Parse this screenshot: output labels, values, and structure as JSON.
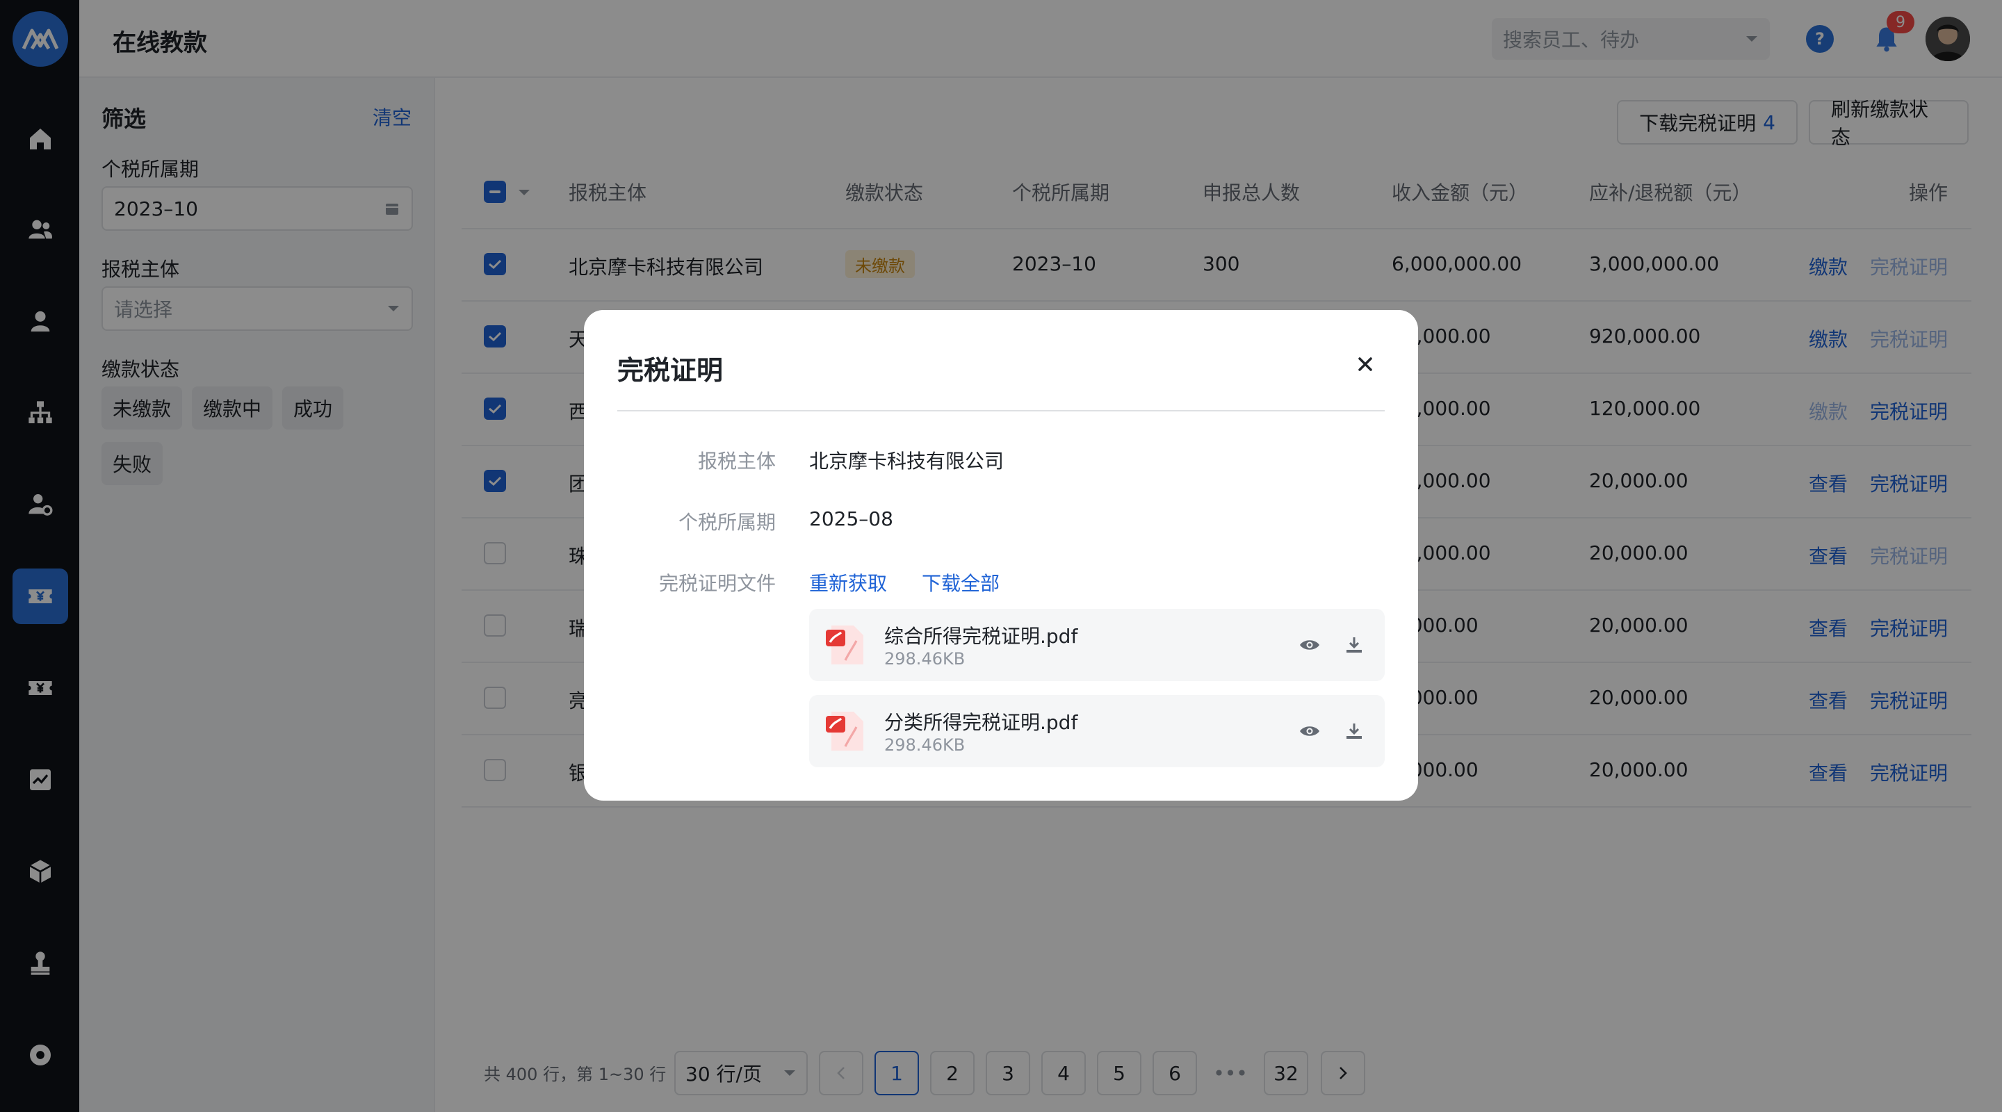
{
  "app": {
    "title": "在线教款"
  },
  "header": {
    "search_placeholder": "搜索员工、待办",
    "help": "?",
    "notification_count": "9"
  },
  "sidebar": {
    "items": [
      "home-icon",
      "team-icon",
      "person-icon",
      "org-chart-icon",
      "user-settings-icon",
      "payment-icon",
      "tax-icon",
      "report-icon",
      "package-icon",
      "stamp-icon",
      "settings-icon"
    ],
    "active_index": 5
  },
  "filter": {
    "title": "筛选",
    "clear": "清空",
    "period_label": "个税所属期",
    "period_value": "2023–10",
    "entity_label": "报税主体",
    "entity_placeholder": "请选择",
    "status_label": "缴款状态",
    "status_chips": [
      "未缴款",
      "缴款中",
      "成功",
      "失败"
    ]
  },
  "toolbar": {
    "download_label": "下载完税证明",
    "download_count": "4",
    "refresh_label": "刷新缴款状态"
  },
  "table": {
    "headers": [
      "报税主体",
      "缴款状态",
      "个税所属期",
      "申报总人数",
      "收入金额（元）",
      "应补/退税额（元）",
      "操作"
    ],
    "rows": [
      {
        "checked": true,
        "entity": "北京摩卡科技有限公司",
        "status": "未缴款",
        "period": "2023–10",
        "count": "300",
        "income": "6,000,000.00",
        "tax": "3,000,000.00",
        "op1": "缴款",
        "op1_disabled": false,
        "op2": "完税证明",
        "op2_disabled": true
      },
      {
        "checked": true,
        "entity": "天",
        "status": "",
        "period": "",
        "count": "",
        "income": "00,000.00",
        "tax": "920,000.00",
        "op1": "缴款",
        "op1_disabled": false,
        "op2": "完税证明",
        "op2_disabled": true
      },
      {
        "checked": true,
        "entity": "西",
        "status": "",
        "period": "",
        "count": "",
        "income": "00,000.00",
        "tax": "120,000.00",
        "op1": "缴款",
        "op1_disabled": true,
        "op2": "完税证明",
        "op2_disabled": false
      },
      {
        "checked": true,
        "entity": "团",
        "status": "",
        "period": "",
        "count": "",
        "income": "00,000.00",
        "tax": "20,000.00",
        "op1": "查看",
        "op1_disabled": false,
        "op2": "完税证明",
        "op2_disabled": false
      },
      {
        "checked": false,
        "entity": "珠",
        "status": "",
        "period": "",
        "count": "",
        "income": "00,000.00",
        "tax": "20,000.00",
        "op1": "查看",
        "op1_disabled": false,
        "op2": "完税证明",
        "op2_disabled": true
      },
      {
        "checked": false,
        "entity": "瑞",
        "status": "",
        "period": "",
        "count": "",
        "income": "0,000.00",
        "tax": "20,000.00",
        "op1": "查看",
        "op1_disabled": false,
        "op2": "完税证明",
        "op2_disabled": false
      },
      {
        "checked": false,
        "entity": "亮",
        "status": "",
        "period": "",
        "count": "",
        "income": "0,000.00",
        "tax": "20,000.00",
        "op1": "查看",
        "op1_disabled": false,
        "op2": "完税证明",
        "op2_disabled": false
      },
      {
        "checked": false,
        "entity": "银",
        "status": "",
        "period": "",
        "count": "",
        "income": "0,000.00",
        "tax": "20,000.00",
        "op1": "查看",
        "op1_disabled": false,
        "op2": "完税证明",
        "op2_disabled": false
      }
    ]
  },
  "pagination": {
    "info": "共 400 行，第 1~30 行",
    "page_size": "30 行/页",
    "pages": [
      "1",
      "2",
      "3",
      "4",
      "5",
      "6"
    ],
    "ellipsis": "•••",
    "last": "32",
    "current": "1"
  },
  "modal": {
    "title": "完税证明",
    "entity_label": "报税主体",
    "entity_value": "北京摩卡科技有限公司",
    "period_label": "个税所属期",
    "period_value": "2025–08",
    "files_label": "完税证明文件",
    "refetch": "重新获取",
    "download_all": "下载全部",
    "files": [
      {
        "name": "综合所得完税证明.pdf",
        "size": "298.46KB"
      },
      {
        "name": "分类所得完税证明.pdf",
        "size": "298.46KB"
      }
    ]
  },
  "colors": {
    "accent": "#1f63d6",
    "sidebar": "#101318",
    "active_nav": "#2a6fd6",
    "warning_tag": "#c7860f",
    "badge": "#f54a45"
  }
}
